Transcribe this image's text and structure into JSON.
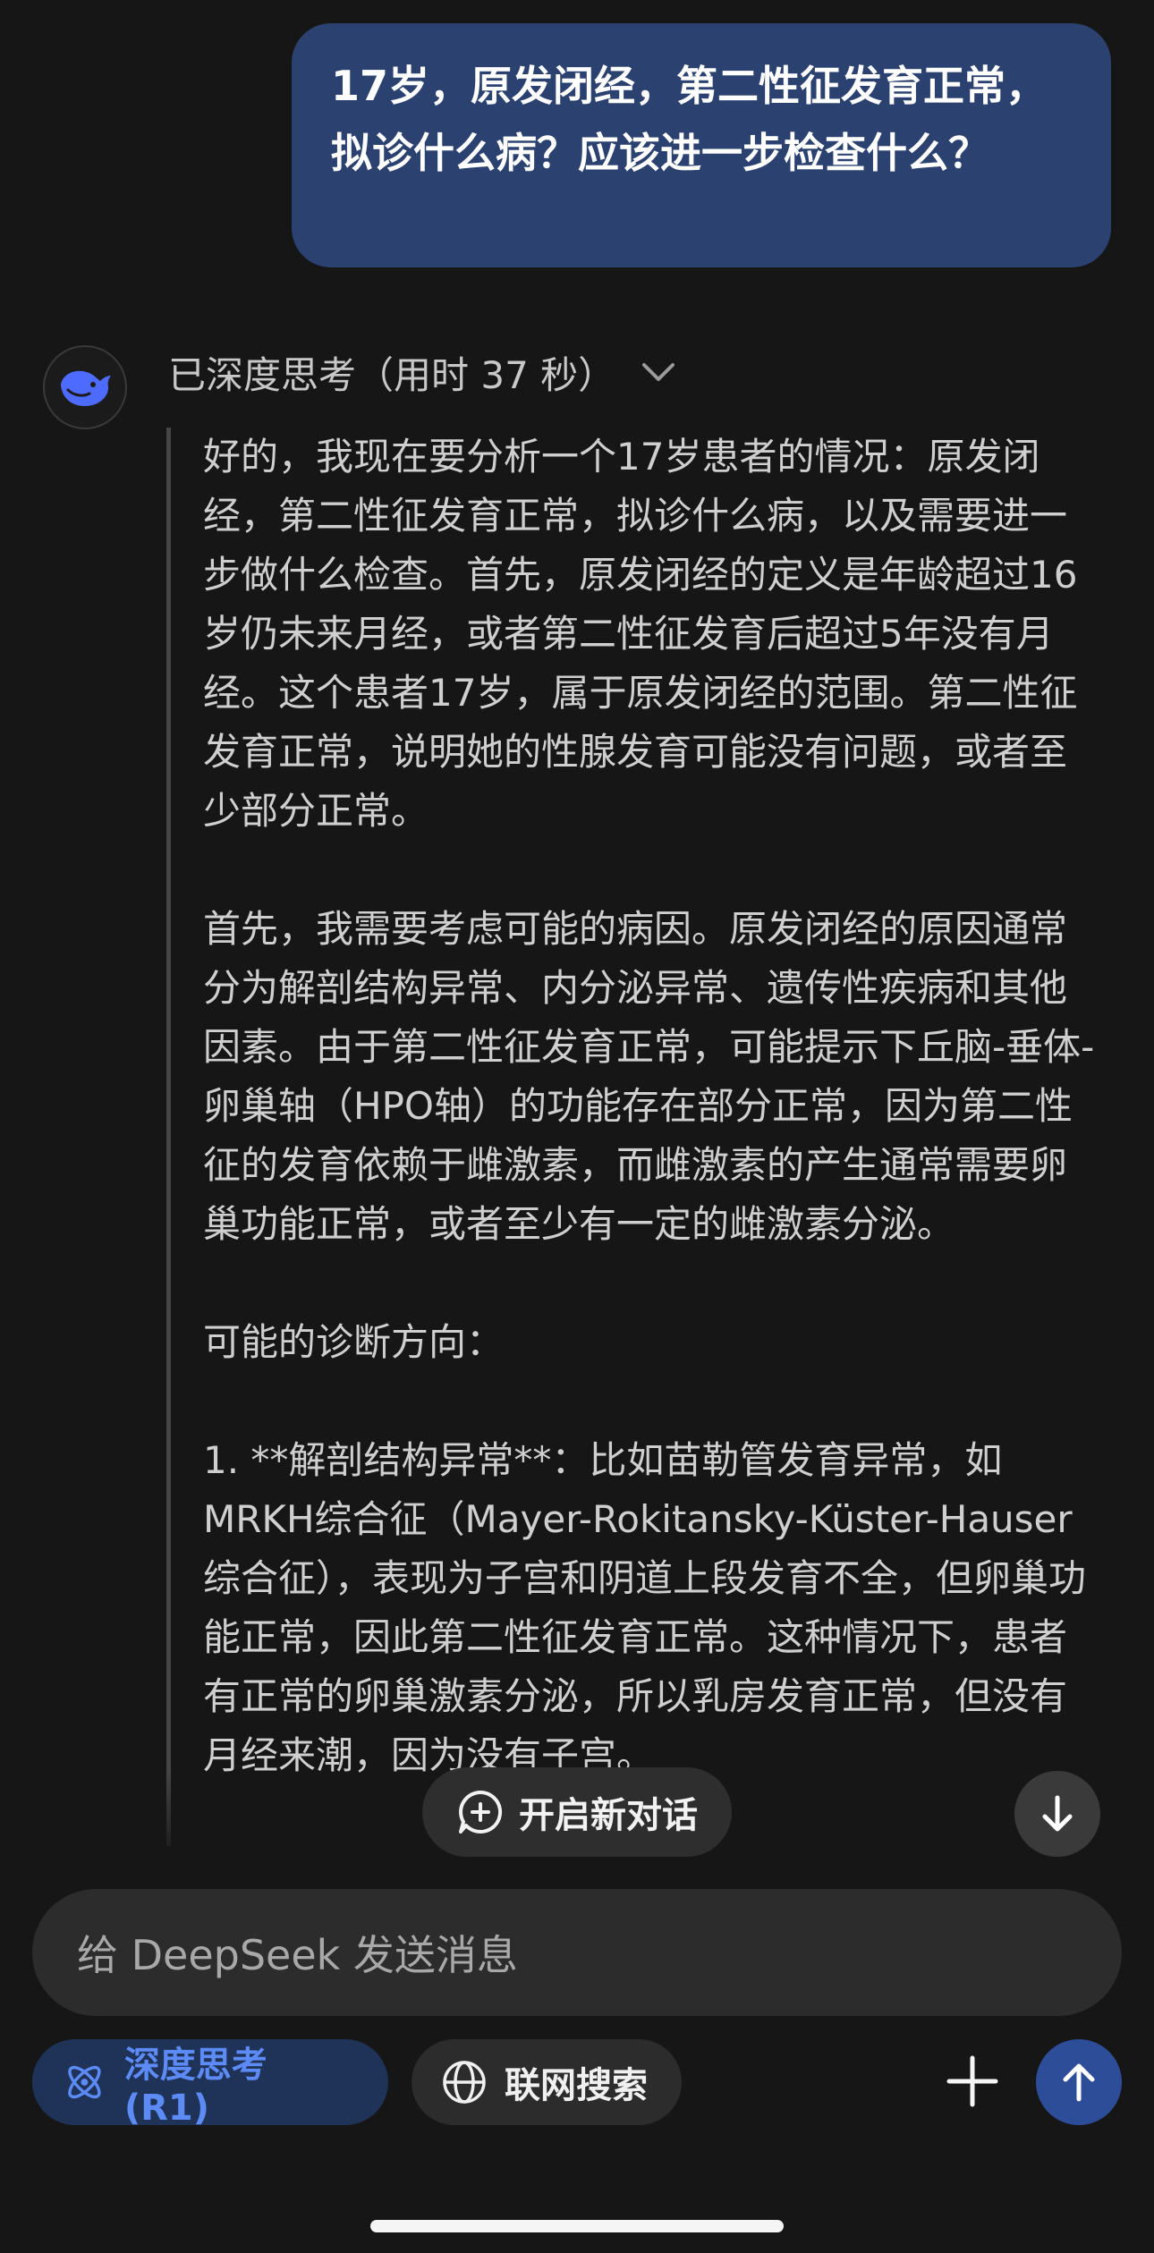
{
  "user_message": "17岁，原发闭经，第二性征发育正常，拟诊什么病？应该进一步检查什么？",
  "assistant": {
    "avatar_icon": "deepseek-whale-icon",
    "think_header": "已深度思考（用时 37 秒）",
    "think_paragraphs": [
      "好的，我现在要分析一个17岁患者的情况：原发闭经，第二性征发育正常，拟诊什么病，以及需要进一步做什么检查。首先，原发闭经的定义是年龄超过16岁仍未来月经，或者第二性征发育后超过5年没有月经。这个患者17岁，属于原发闭经的范围。第二性征发育正常，说明她的性腺发育可能没有问题，或者至少部分正常。",
      "首先，我需要考虑可能的病因。原发闭经的原因通常分为解剖结构异常、内分泌异常、遗传性疾病和其他因素。由于第二性征发育正常，可能提示下丘脑-垂体-卵巢轴（HPO轴）的功能存在部分正常，因为第二性征的发育依赖于雌激素，而雌激素的产生通常需要卵巢功能正常，或者至少有一定的雌激素分泌。",
      "可能的诊断方向：",
      "1. **解剖结构异常**：比如苗勒管发育异常，如MRKH综合征（Mayer-Rokitansky-Küster-Hauser综合征），表现为子宫和阴道上段发育不全，但卵巢功能正常，因此第二性征发育正常。这种情况下，患者有正常的卵巢激素分泌，所以乳房发育正常，但没有月经来潮，因为没有子宫。"
    ]
  },
  "new_chat_label": "开启新对话",
  "input_placeholder": "给 DeepSeek 发送消息",
  "chips": {
    "deep_think": "深度思考 (R1)",
    "web_search": "联网搜索"
  },
  "colors": {
    "background": "#161616",
    "user_bubble": "#2b4170",
    "accent_blue": "#5d8bf5",
    "send_button": "#2d4d99"
  }
}
